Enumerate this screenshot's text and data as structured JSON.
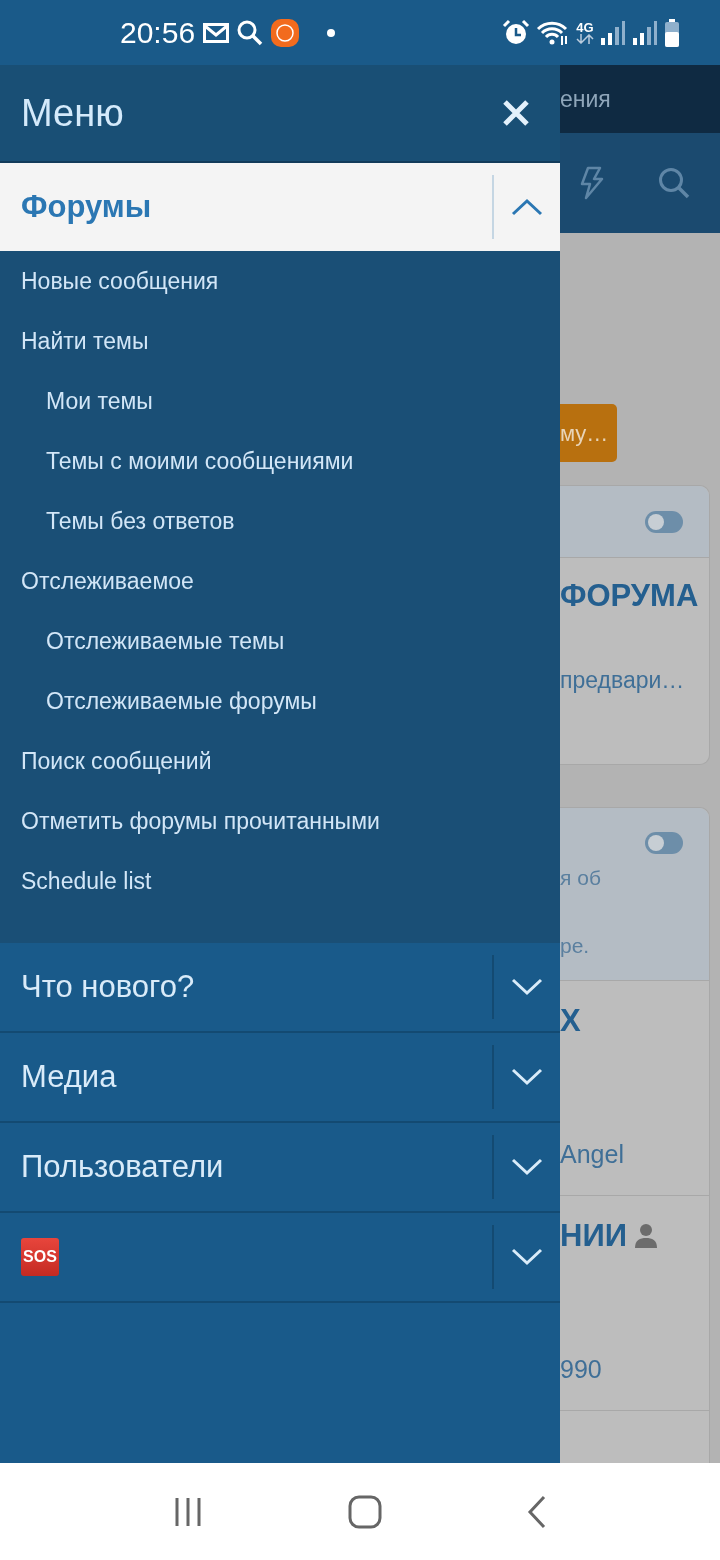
{
  "status_bar": {
    "time": "20:56",
    "network": "4G"
  },
  "drawer": {
    "title": "Меню",
    "sections": [
      {
        "label": "Форумы",
        "kind": "text",
        "expanded": true,
        "children": [
          {
            "label": "Новые сообщения"
          },
          {
            "label": "Найти темы",
            "children": [
              {
                "label": "Мои темы"
              },
              {
                "label": "Темы с моими сообщениями"
              },
              {
                "label": "Темы без ответов"
              }
            ]
          },
          {
            "label": "Отслеживаемое",
            "children": [
              {
                "label": "Отслеживаемые темы"
              },
              {
                "label": "Отслеживаемые форумы"
              }
            ]
          },
          {
            "label": "Поиск сообщений"
          },
          {
            "label": "Отметить форумы прочитанными"
          },
          {
            "label": "Schedule list"
          }
        ]
      },
      {
        "label": "Что нового?",
        "kind": "text",
        "expanded": false
      },
      {
        "label": "Медиа",
        "kind": "text",
        "expanded": false
      },
      {
        "label": "Пользователи",
        "kind": "text",
        "expanded": false
      },
      {
        "label": "SOS",
        "kind": "emoji",
        "expanded": false
      }
    ]
  },
  "page_behind": {
    "header_text": "ения",
    "button": "му…",
    "cards": [
      {
        "toggle_on": false,
        "title": "ФОРУМА",
        "text": "предвари…"
      },
      {
        "toggle_on": false,
        "lines": [
          "я об",
          "ре."
        ]
      }
    ],
    "rows": [
      {
        "title": "Х",
        "text": "Angel"
      },
      {
        "title": "НИИ",
        "text": "990"
      }
    ]
  }
}
